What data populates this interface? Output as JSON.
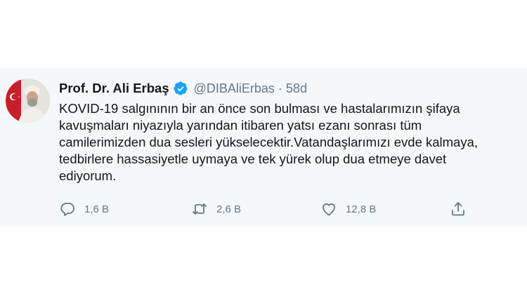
{
  "tweet": {
    "author_name": "Prof. Dr. Ali Erbaş",
    "handle": "@DIBAliErbas",
    "separator": "·",
    "time": "58d",
    "lines": [
      "KOVID-19 salgınının bir an önce son bulması ve hastalarımızın şifaya",
      "kavuşmaları niyazıyla yarından itibaren yatsı ezanı sonrası tüm",
      "camilerimizden dua sesleri yükselecektir.Vatandaşlarımızı evde kalmaya,",
      "tedbirlere hassasiyetle uymaya ve tek yürek olup dua etmeye davet",
      "ediyorum."
    ]
  },
  "actions": {
    "reply_count": "1,6 B",
    "retweet_count": "2,6 B",
    "like_count": "12,8 B"
  },
  "icons": {
    "reply": "reply-icon",
    "retweet": "retweet-icon",
    "like": "like-icon",
    "share": "share-icon",
    "verified": "verified-badge-icon"
  },
  "colors": {
    "card_background": "#f5f8fa",
    "text": "#14171a",
    "muted": "#657786",
    "verified_blue": "#1da1f2"
  }
}
